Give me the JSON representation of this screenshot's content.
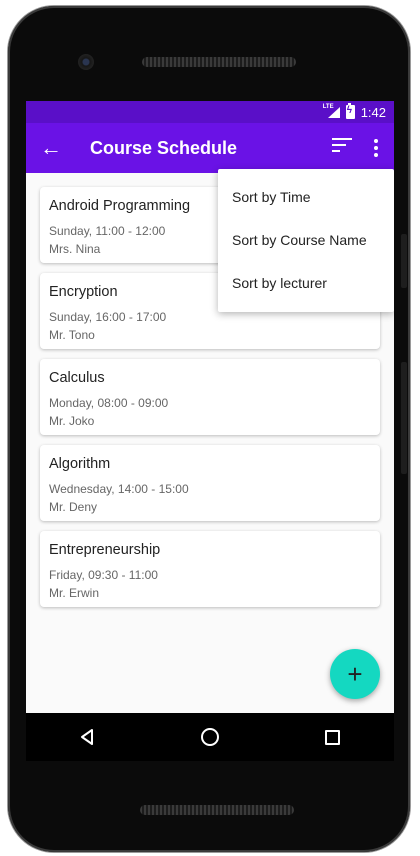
{
  "status": {
    "network": "LTE",
    "time": "1:42"
  },
  "appbar": {
    "title": "Course Schedule",
    "back_icon": "arrow-back-icon",
    "sort_icon": "sort-icon",
    "more_icon": "more-vert-icon"
  },
  "courses": [
    {
      "name": "Android Programming",
      "time": "Sunday, 11:00 - 12:00",
      "lecturer": "Mrs. Nina"
    },
    {
      "name": "Encryption",
      "time": "Sunday, 16:00 - 17:00",
      "lecturer": "Mr. Tono"
    },
    {
      "name": "Calculus",
      "time": "Monday, 08:00 - 09:00",
      "lecturer": "Mr. Joko"
    },
    {
      "name": "Algorithm",
      "time": "Wednesday, 14:00 - 15:00",
      "lecturer": "Mr. Deny"
    },
    {
      "name": "Entrepreneurship",
      "time": "Friday, 09:30 - 11:00",
      "lecturer": "Mr. Erwin"
    }
  ],
  "menu": {
    "items": [
      "Sort by Time",
      "Sort by Course Name",
      "Sort by lecturer"
    ]
  },
  "fab": {
    "label": "+"
  },
  "colors": {
    "statusbar": "#5a0fc8",
    "appbar": "#6a12e6",
    "fab": "#14d8c1"
  }
}
